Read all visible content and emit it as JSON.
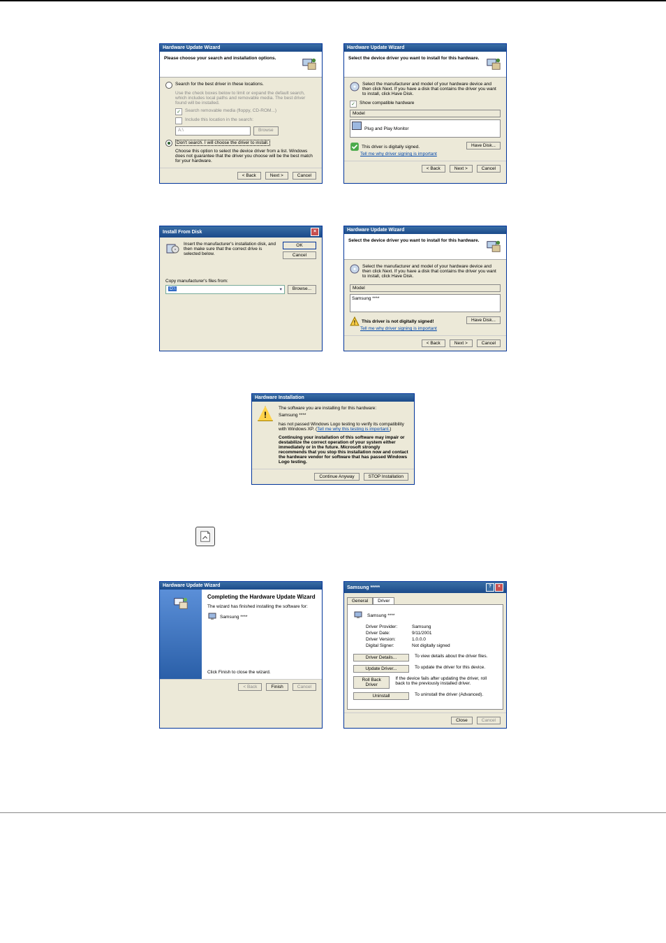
{
  "d1": {
    "title": "Hardware Update Wizard",
    "heading": "Please choose your search and installation options.",
    "r1": "Search for the best driver in these locations.",
    "r1desc": "Use the check boxes below to limit or expand the default search, which includes local paths and removable media. The best driver found will be installed.",
    "c1": "Search removable media (floppy, CD-ROM...)",
    "c2": "Include this location in the search:",
    "path": "A:\\",
    "browse": "Browse",
    "r2": "Don't search. I will choose the driver to install.",
    "r2desc": "Choose this option to select the device driver from a list. Windows does not guarantee that the driver you choose will be the best match for your hardware.",
    "back": "< Back",
    "next": "Next >",
    "cancel": "Cancel"
  },
  "d2": {
    "title": "Hardware Update Wizard",
    "heading": "Select the device driver you want to install for this hardware.",
    "desc": "Select the manufacturer and model of your hardware device and then click Next. If you have a disk that contains the driver you want to install, click Have Disk.",
    "show": "Show compatible hardware",
    "modelhdr": "Model",
    "model": "Plug and Play Monitor",
    "signed": "This driver is digitally signed.",
    "tell": "Tell me why driver signing is important",
    "have": "Have Disk...",
    "back": "< Back",
    "next": "Next >",
    "cancel": "Cancel"
  },
  "d3": {
    "title": "Install From Disk",
    "msg": "Insert the manufacturer's installation disk, and then make sure that the correct drive is selected below.",
    "copy": "Copy manufacturer's files from:",
    "path": "D:\\",
    "ok": "OK",
    "cancel": "Cancel",
    "browse": "Browse..."
  },
  "d4": {
    "title": "Hardware Update Wizard",
    "heading": "Select the device driver you want to install for this hardware.",
    "desc": "Select the manufacturer and model of your hardware device and then click Next. If you have a disk that contains the driver you want to install, click Have Disk.",
    "modelhdr": "Model",
    "model": "Samsung ****",
    "warn": "This driver is not digitally signed!",
    "tell": "Tell me why driver signing is important",
    "have": "Have Disk...",
    "back": "< Back",
    "next": "Next >",
    "cancel": "Cancel"
  },
  "d5": {
    "title": "Hardware Installation",
    "line1": "The software you are installing for this hardware:",
    "model": "Samsung ****",
    "line2a": "has not passed Windows Logo testing to verify its compatibility with Windows XP. (",
    "line2link": "Tell me why this testing is important.",
    "line2b": ")",
    "bold": "Continuing your installation of this software may impair or destabilize the correct operation of your system either immediately or in the future. Microsoft strongly recommends that you stop this installation now and contact the hardware vendor for software that has passed Windows Logo testing.",
    "cont": "Continue Anyway",
    "stop": "STOP Installation"
  },
  "d6": {
    "title": "Hardware Update Wizard",
    "heading": "Completing the Hardware Update Wizard",
    "line": "The wizard has finished installing the software for:",
    "model": "Samsung ****",
    "close": "Click Finish to close the wizard.",
    "back": "< Back",
    "finish": "Finish",
    "cancel": "Cancel"
  },
  "d7": {
    "title": "Samsung ***** ",
    "tab1": "General",
    "tab2": "Driver",
    "name": "Samsung ****",
    "provider_k": "Driver Provider:",
    "provider_v": "Samsung",
    "date_k": "Driver Date:",
    "date_v": "9/11/2001",
    "ver_k": "Driver Version:",
    "ver_v": "1.0.0.0",
    "sign_k": "Digital Signer:",
    "sign_v": "Not digitally signed",
    "b1": "Driver Details...",
    "b1d": "To view details about the driver files.",
    "b2": "Update Driver...",
    "b2d": "To update the driver for this device.",
    "b3": "Roll Back Driver",
    "b3d": "If the device fails after updating the driver, roll back to the previously installed driver.",
    "b4": "Uninstall",
    "b4d": "To uninstall the driver (Advanced).",
    "close": "Close",
    "cancel": "Cancel"
  }
}
